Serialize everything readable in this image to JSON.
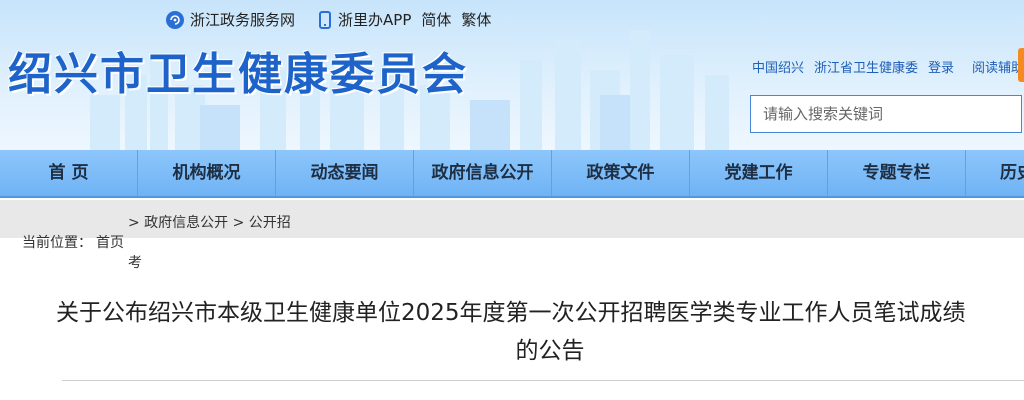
{
  "topbar": {
    "gov_service": "浙江政务服务网",
    "app": "浙里办APP",
    "simplified": "简体",
    "traditional": "繁体"
  },
  "site": {
    "title": "绍兴市卫生健康委员会"
  },
  "links": {
    "china_shaoxing": "中国绍兴",
    "province_health": "浙江省卫生健康委",
    "login": "登录",
    "accessibility": "阅读辅助"
  },
  "search": {
    "placeholder": "请输入搜索关键词"
  },
  "nav": {
    "items": [
      {
        "label": "首 页"
      },
      {
        "label": "机构概况"
      },
      {
        "label": "动态要闻"
      },
      {
        "label": "政府信息公开"
      },
      {
        "label": "政策文件"
      },
      {
        "label": "党建工作"
      },
      {
        "label": "专题专栏"
      },
      {
        "label": "历史"
      }
    ]
  },
  "breadcrumb": {
    "label": "当前位置：",
    "home": "首页",
    "mid": "> 政府信息公开 > 公开招",
    "tail": "考"
  },
  "article": {
    "title_line1": "关于公布绍兴市本级卫生健康单位2025年度第一次公开招聘医学类专业工作人员笔试成绩",
    "title_line2": "的公告"
  },
  "colors": {
    "brand": "#1d63c9",
    "nav_bg": "#7dbcf8",
    "accent": "#f58a1f"
  }
}
